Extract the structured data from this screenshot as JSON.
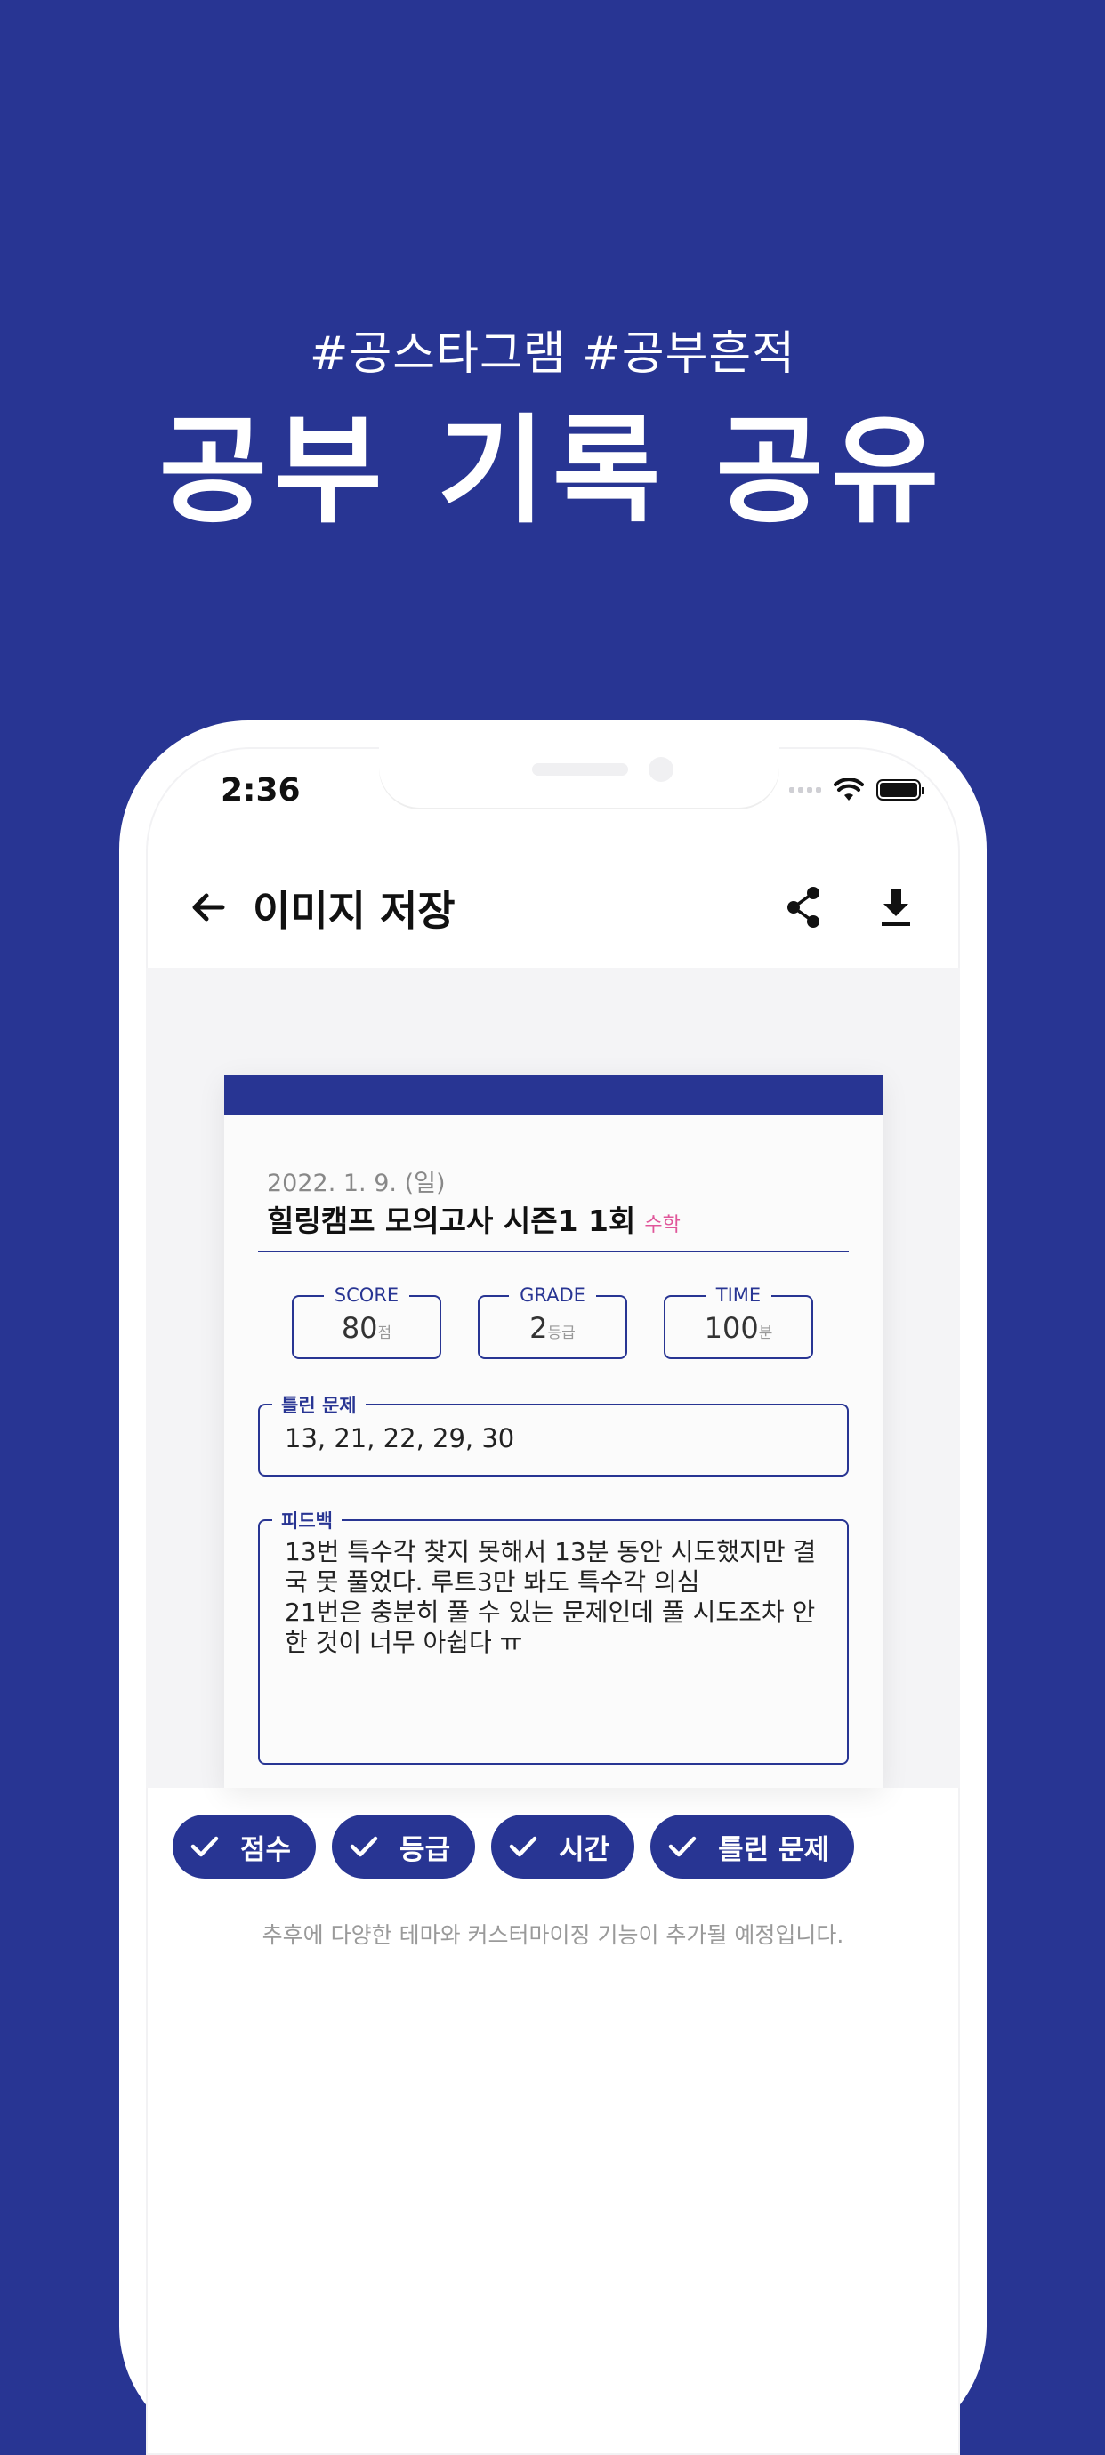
{
  "promo": {
    "subtitle": "#공스타그램 #공부흔적",
    "title": "공부 기록 공유"
  },
  "status_bar": {
    "time": "2:36"
  },
  "app_bar": {
    "title": "이미지 저장"
  },
  "card": {
    "date": "2022. 1. 9. (일)",
    "exam_title": "힐링캠프 모의고사 시즌1 1회",
    "subject": "수학",
    "stats": [
      {
        "label": "SCORE",
        "value": "80",
        "unit": "점"
      },
      {
        "label": "GRADE",
        "value": "2",
        "unit": "등급"
      },
      {
        "label": "TIME",
        "value": "100",
        "unit": "분"
      }
    ],
    "wrong_label": "틀린 문제",
    "wrong_value": "13, 21, 22, 29, 30",
    "feedback_label": "피드백",
    "feedback_value": "13번 특수각 찾지 못해서 13분 동안 시도했지만 결\n국 못 풀었다. 루트3만 봐도 특수각 의심\n21번은 충분히 풀 수 있는 문제인데 풀 시도조차 안\n한 것이 너무 아쉽다 ㅠ"
  },
  "toggles": [
    {
      "label": "점수",
      "checked": true
    },
    {
      "label": "등급",
      "checked": true
    },
    {
      "label": "시간",
      "checked": true
    },
    {
      "label": "틀린 문제",
      "checked": true
    }
  ],
  "note": "추후에 다양한 테마와 커스터마이징 기능이 추가될 예정입니다.",
  "colors": {
    "background": "#283593",
    "accent": "#283593",
    "subject": "#e0569a"
  },
  "icons": [
    "back-arrow-icon",
    "share-icon",
    "download-icon",
    "check-icon",
    "wifi-icon",
    "battery-icon"
  ]
}
